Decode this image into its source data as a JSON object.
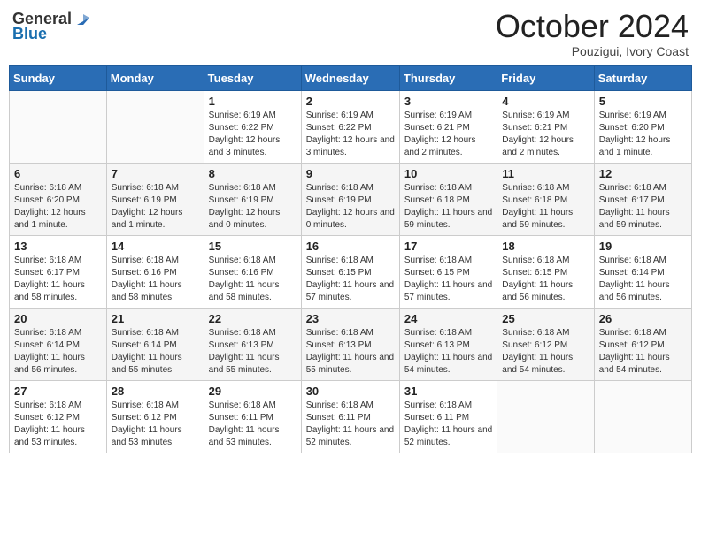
{
  "header": {
    "logo_general": "General",
    "logo_blue": "Blue",
    "month_title": "October 2024",
    "subtitle": "Pouzigui, Ivory Coast"
  },
  "weekdays": [
    "Sunday",
    "Monday",
    "Tuesday",
    "Wednesday",
    "Thursday",
    "Friday",
    "Saturday"
  ],
  "weeks": [
    [
      {
        "day": "",
        "info": ""
      },
      {
        "day": "",
        "info": ""
      },
      {
        "day": "1",
        "info": "Sunrise: 6:19 AM\nSunset: 6:22 PM\nDaylight: 12 hours and 3 minutes."
      },
      {
        "day": "2",
        "info": "Sunrise: 6:19 AM\nSunset: 6:22 PM\nDaylight: 12 hours and 3 minutes."
      },
      {
        "day": "3",
        "info": "Sunrise: 6:19 AM\nSunset: 6:21 PM\nDaylight: 12 hours and 2 minutes."
      },
      {
        "day": "4",
        "info": "Sunrise: 6:19 AM\nSunset: 6:21 PM\nDaylight: 12 hours and 2 minutes."
      },
      {
        "day": "5",
        "info": "Sunrise: 6:19 AM\nSunset: 6:20 PM\nDaylight: 12 hours and 1 minute."
      }
    ],
    [
      {
        "day": "6",
        "info": "Sunrise: 6:18 AM\nSunset: 6:20 PM\nDaylight: 12 hours and 1 minute."
      },
      {
        "day": "7",
        "info": "Sunrise: 6:18 AM\nSunset: 6:19 PM\nDaylight: 12 hours and 1 minute."
      },
      {
        "day": "8",
        "info": "Sunrise: 6:18 AM\nSunset: 6:19 PM\nDaylight: 12 hours and 0 minutes."
      },
      {
        "day": "9",
        "info": "Sunrise: 6:18 AM\nSunset: 6:19 PM\nDaylight: 12 hours and 0 minutes."
      },
      {
        "day": "10",
        "info": "Sunrise: 6:18 AM\nSunset: 6:18 PM\nDaylight: 11 hours and 59 minutes."
      },
      {
        "day": "11",
        "info": "Sunrise: 6:18 AM\nSunset: 6:18 PM\nDaylight: 11 hours and 59 minutes."
      },
      {
        "day": "12",
        "info": "Sunrise: 6:18 AM\nSunset: 6:17 PM\nDaylight: 11 hours and 59 minutes."
      }
    ],
    [
      {
        "day": "13",
        "info": "Sunrise: 6:18 AM\nSunset: 6:17 PM\nDaylight: 11 hours and 58 minutes."
      },
      {
        "day": "14",
        "info": "Sunrise: 6:18 AM\nSunset: 6:16 PM\nDaylight: 11 hours and 58 minutes."
      },
      {
        "day": "15",
        "info": "Sunrise: 6:18 AM\nSunset: 6:16 PM\nDaylight: 11 hours and 58 minutes."
      },
      {
        "day": "16",
        "info": "Sunrise: 6:18 AM\nSunset: 6:15 PM\nDaylight: 11 hours and 57 minutes."
      },
      {
        "day": "17",
        "info": "Sunrise: 6:18 AM\nSunset: 6:15 PM\nDaylight: 11 hours and 57 minutes."
      },
      {
        "day": "18",
        "info": "Sunrise: 6:18 AM\nSunset: 6:15 PM\nDaylight: 11 hours and 56 minutes."
      },
      {
        "day": "19",
        "info": "Sunrise: 6:18 AM\nSunset: 6:14 PM\nDaylight: 11 hours and 56 minutes."
      }
    ],
    [
      {
        "day": "20",
        "info": "Sunrise: 6:18 AM\nSunset: 6:14 PM\nDaylight: 11 hours and 56 minutes."
      },
      {
        "day": "21",
        "info": "Sunrise: 6:18 AM\nSunset: 6:14 PM\nDaylight: 11 hours and 55 minutes."
      },
      {
        "day": "22",
        "info": "Sunrise: 6:18 AM\nSunset: 6:13 PM\nDaylight: 11 hours and 55 minutes."
      },
      {
        "day": "23",
        "info": "Sunrise: 6:18 AM\nSunset: 6:13 PM\nDaylight: 11 hours and 55 minutes."
      },
      {
        "day": "24",
        "info": "Sunrise: 6:18 AM\nSunset: 6:13 PM\nDaylight: 11 hours and 54 minutes."
      },
      {
        "day": "25",
        "info": "Sunrise: 6:18 AM\nSunset: 6:12 PM\nDaylight: 11 hours and 54 minutes."
      },
      {
        "day": "26",
        "info": "Sunrise: 6:18 AM\nSunset: 6:12 PM\nDaylight: 11 hours and 54 minutes."
      }
    ],
    [
      {
        "day": "27",
        "info": "Sunrise: 6:18 AM\nSunset: 6:12 PM\nDaylight: 11 hours and 53 minutes."
      },
      {
        "day": "28",
        "info": "Sunrise: 6:18 AM\nSunset: 6:12 PM\nDaylight: 11 hours and 53 minutes."
      },
      {
        "day": "29",
        "info": "Sunrise: 6:18 AM\nSunset: 6:11 PM\nDaylight: 11 hours and 53 minutes."
      },
      {
        "day": "30",
        "info": "Sunrise: 6:18 AM\nSunset: 6:11 PM\nDaylight: 11 hours and 52 minutes."
      },
      {
        "day": "31",
        "info": "Sunrise: 6:18 AM\nSunset: 6:11 PM\nDaylight: 11 hours and 52 minutes."
      },
      {
        "day": "",
        "info": ""
      },
      {
        "day": "",
        "info": ""
      }
    ]
  ]
}
